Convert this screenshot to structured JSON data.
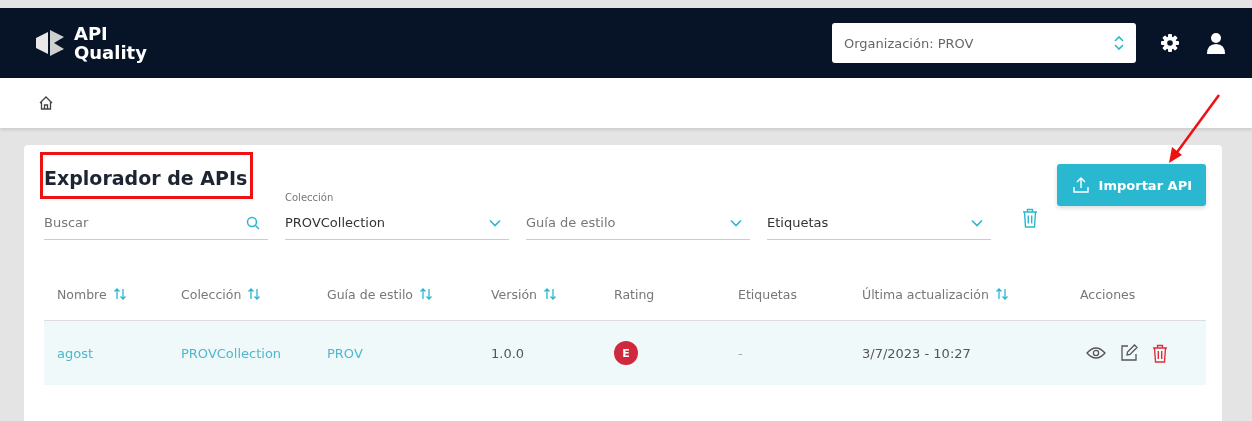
{
  "navbar": {
    "logo": [
      "API",
      "Quality"
    ],
    "organization_select": {
      "value": "Organización: PROV"
    }
  },
  "page": {
    "title": "Explorador de APIs",
    "import_button": "Importar API"
  },
  "filters": [
    {
      "kind": "search",
      "placeholder": "Buscar"
    },
    {
      "kind": "select",
      "label": "Colección",
      "value": "PROVCollection"
    },
    {
      "kind": "select",
      "placeholder": "Guía de estilo"
    },
    {
      "kind": "select",
      "value": "Etiquetas"
    }
  ],
  "table": {
    "columns": [
      {
        "label": "Nombre",
        "sortable": true
      },
      {
        "label": "Colección",
        "sortable": true
      },
      {
        "label": "Guía de estilo",
        "sortable": true
      },
      {
        "label": "Versión",
        "sortable": true
      },
      {
        "label": "Rating",
        "sortable": false
      },
      {
        "label": "Etiquetas",
        "sortable": false
      },
      {
        "label": "Última actualización",
        "sortable": true
      },
      {
        "label": "Acciones",
        "sortable": false
      }
    ],
    "rows": [
      {
        "nombre": "agost",
        "coleccion": "PROVCollection",
        "guia": "PROV",
        "version": "1.0.0",
        "rating": {
          "grade": "E",
          "color": "#d0283c"
        },
        "etiquetas": "-",
        "actualizacion": "3/7/2023 - 10:27"
      }
    ]
  }
}
